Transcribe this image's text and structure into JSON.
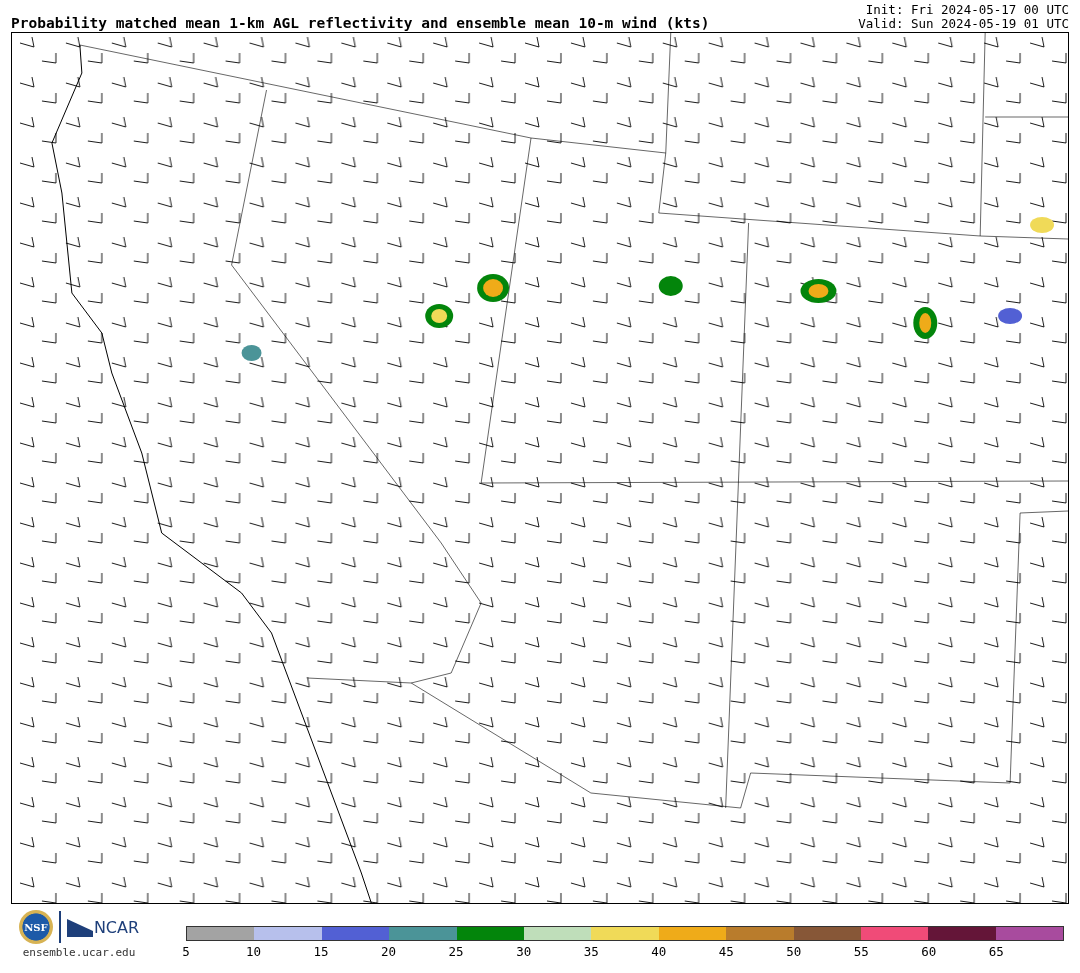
{
  "header": {
    "title": "Probability matched mean 1-km AGL reflectivity and ensemble mean 10-m wind (kts)",
    "init": "Init: Fri 2024-05-17 00 UTC",
    "valid": "Valid: Sun 2024-05-19 01 UTC"
  },
  "footer": {
    "seal_text": "NSF",
    "brand": "NCAR",
    "url": "ensemble.ucar.edu"
  },
  "colorbar": {
    "segments": [
      {
        "color": "#a3a3a3"
      },
      {
        "color": "#b7c0ec"
      },
      {
        "color": "#5260d4"
      },
      {
        "color": "#4b9498"
      },
      {
        "color": "#03850b"
      },
      {
        "color": "#bfdeba"
      },
      {
        "color": "#f0da58"
      },
      {
        "color": "#efab19"
      },
      {
        "color": "#b97c2c"
      },
      {
        "color": "#875737"
      },
      {
        "color": "#f04b78"
      },
      {
        "color": "#641538"
      },
      {
        "color": "#a84b9e"
      }
    ],
    "ticks": [
      "5",
      "10",
      "15",
      "20",
      "25",
      "30",
      "35",
      "40",
      "45",
      "50",
      "55",
      "60",
      "65"
    ]
  }
}
